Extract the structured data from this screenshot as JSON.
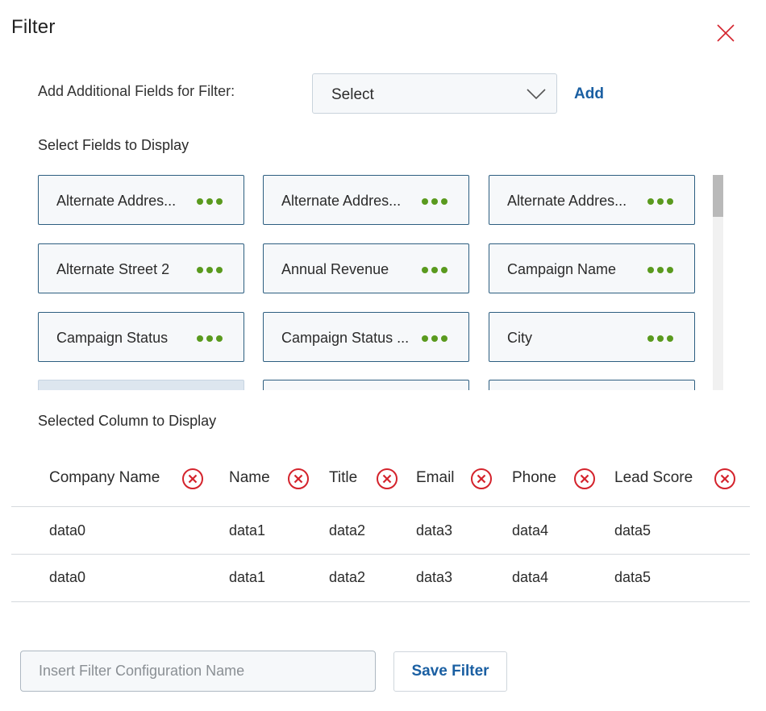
{
  "dialog": {
    "title": "Filter"
  },
  "additional": {
    "label": "Add Additional Fields for Filter:",
    "select_value": "Select",
    "add_label": "Add"
  },
  "fields_section": {
    "title": "Select Fields to Display",
    "cards": [
      "Alternate Addres...",
      "Alternate Addres...",
      "Alternate Addres...",
      "Alternate Street 2",
      "Annual Revenue",
      "Campaign Name",
      "Campaign Status",
      "Campaign Status ...",
      "City"
    ]
  },
  "columns_section": {
    "title": "Selected Column to Display",
    "headers": [
      "Company Name",
      "Name",
      "Title",
      "Email",
      "Phone",
      "Lead Score"
    ],
    "rows": [
      [
        "data0",
        "data1",
        "data2",
        "data3",
        "data4",
        "data5"
      ],
      [
        "data0",
        "data1",
        "data2",
        "data3",
        "data4",
        "data5"
      ]
    ]
  },
  "footer": {
    "name_placeholder": "Insert Filter Configuration Name",
    "save_label": "Save Filter"
  },
  "colors": {
    "accent_blue": "#1a5fa2",
    "dots_green": "#5a9a1e",
    "remove_red": "#d4232c",
    "card_border": "#2d5e80"
  }
}
